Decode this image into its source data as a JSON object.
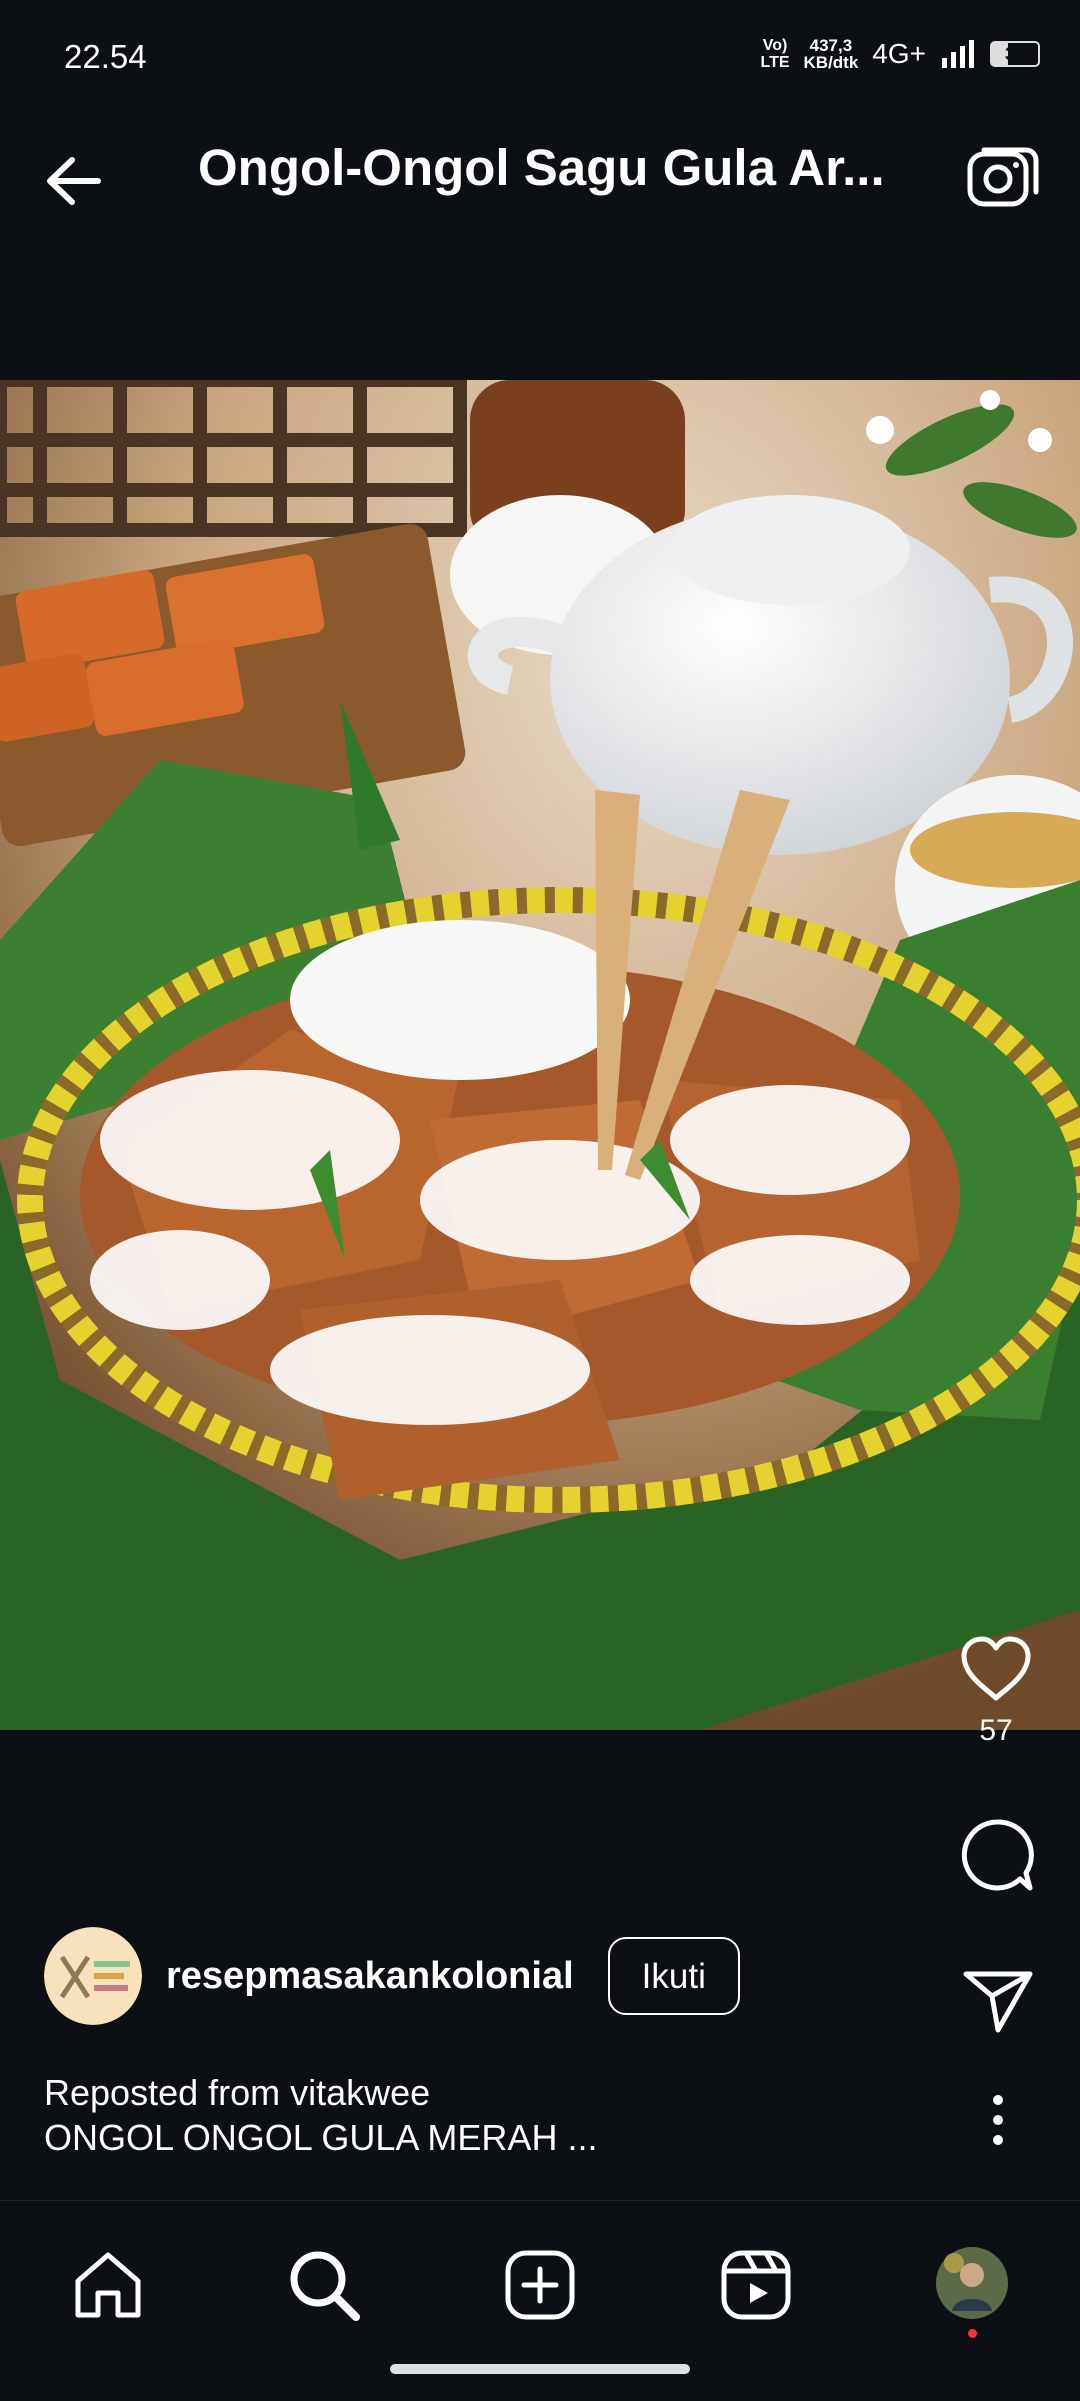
{
  "status_bar": {
    "time": "22.54",
    "volte_top": "Vo)",
    "volte_bottom": "LTE",
    "speed_value": "437,3",
    "speed_unit": "KB/dtk",
    "network": "4G+",
    "battery": "34",
    "battery_level": 0.34
  },
  "header": {
    "title": "Ongol-Ongol Sagu Gula Ar...",
    "back_icon": "arrow-left-icon",
    "camera_icon": "camera-icon"
  },
  "post": {
    "image_icon": "food-photo",
    "likes": "57",
    "author": {
      "username": "resepmasakankolonial",
      "follow_label": "Ikuti"
    },
    "caption": {
      "line1": "Reposted from vitakwee",
      "line2": "ONGOL ONGOL GULA MERAH ..."
    }
  },
  "bottom_nav": {
    "items": [
      "home-icon",
      "search-icon",
      "create-icon",
      "reels-icon",
      "profile-avatar"
    ]
  },
  "colors": {
    "background": "#0c1014",
    "text": "#ffffff",
    "notification_dot": "#ff3040"
  }
}
